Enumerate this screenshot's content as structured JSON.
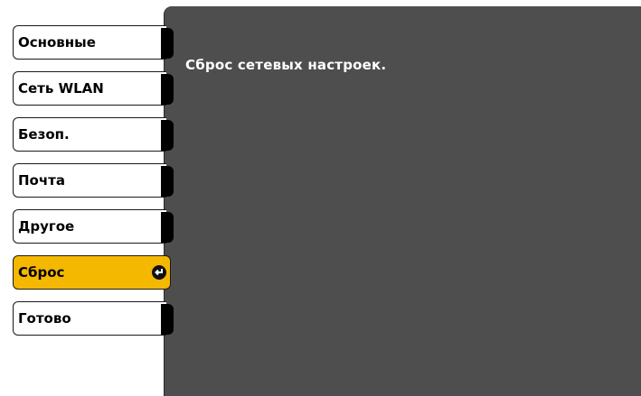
{
  "menu": {
    "items": [
      {
        "label": "Основные"
      },
      {
        "label": "Сеть WLAN"
      },
      {
        "label": "Безоп."
      },
      {
        "label": "Почта"
      },
      {
        "label": "Другое"
      },
      {
        "label": "Сброс",
        "active": true,
        "icon": "enter-icon"
      },
      {
        "label": "Готово"
      }
    ]
  },
  "content": {
    "text": "Сброс сетевых настроек."
  },
  "colors": {
    "active_tab": "#f5b800",
    "panel_bg": "#4e4e4e",
    "tab_bg": "#ffffff"
  }
}
